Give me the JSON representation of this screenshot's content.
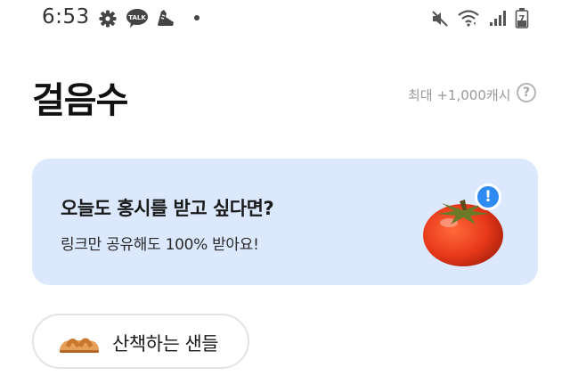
{
  "status_bar": {
    "time": "6:53",
    "talk_badge": "TALK",
    "battery_level": "7",
    "icons": [
      "gear-icon",
      "kakaotalk-icon",
      "sneaker-icon",
      "notification-dot-icon",
      "mute-icon",
      "wifi-icon",
      "signal-icon",
      "battery-icon"
    ]
  },
  "header": {
    "title": "걸음수",
    "max_reward": "최대 +1,000캐시",
    "help_label": "?"
  },
  "promo": {
    "title": "오늘도 홍시를 받고 싶다면?",
    "subtitle": "링크만 공유해도 100% 받아요!",
    "badge_label": "!",
    "icon": "persimmon-icon",
    "background": "#dbe8fd",
    "badge_color": "#2d8bf2"
  },
  "chip": {
    "label": "산책하는 샌들",
    "icon": "sandal-icon"
  }
}
